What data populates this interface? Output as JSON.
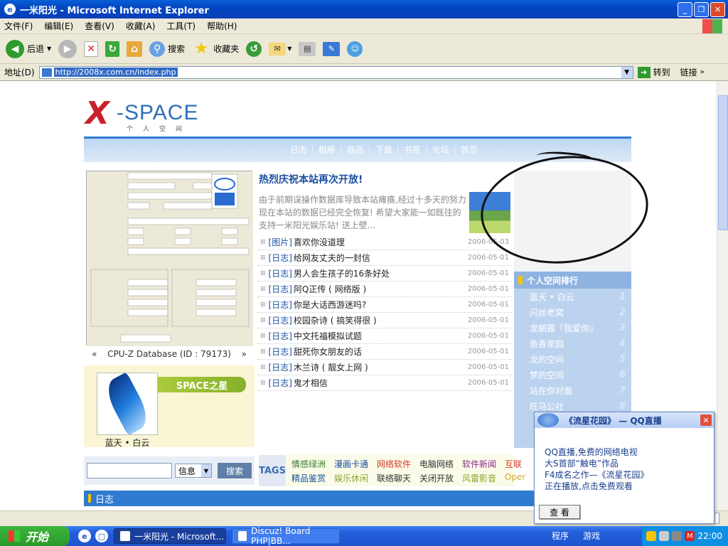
{
  "window": {
    "title": "一米阳光 - Microsoft Internet Explorer"
  },
  "menu": [
    "文件(F)",
    "编辑(E)",
    "查看(V)",
    "收藏(A)",
    "工具(T)",
    "帮助(H)"
  ],
  "toolbar": {
    "back": "后退",
    "search": "搜索",
    "favorites": "收藏夹"
  },
  "address": {
    "label": "地址(D)",
    "url": "http://2008x.com.cn/index.php",
    "go": "转到",
    "links": "链接"
  },
  "logo": {
    "x": "X",
    "space": "-SPACE",
    "sub": "个人空间"
  },
  "nav": [
    "日志",
    "相册",
    "商品",
    "下载",
    "书签",
    "论坛",
    "首页"
  ],
  "cpuz": {
    "prev": "«",
    "caption": "CPU-Z Database (ID : 79173)",
    "next": "»"
  },
  "star": {
    "badge": "SPACE之星",
    "name": "蓝天 • 白云"
  },
  "search": {
    "option": "信息",
    "button": "搜索"
  },
  "news": {
    "title": "热烈庆祝本站再次开放!",
    "body": "由于前期误操作数据库导致本站瘫痪,经过十多天的努力现在本站的数据已经完全恢复! 希望大家能一如既往的支持一米阳光娱乐站! 送上壁..."
  },
  "articles": [
    {
      "cat": "[图片]",
      "title": "喜欢你没道理",
      "date": "2006-05-03"
    },
    {
      "cat": "[日志]",
      "title": "给网友丈夫的一封信",
      "date": "2006-05-01"
    },
    {
      "cat": "[日志]",
      "title": "男人会生孩子的16条好处",
      "date": "2006-05-01"
    },
    {
      "cat": "[日志]",
      "title": "阿Q正传 ( 网络版 )",
      "date": "2006-05-01"
    },
    {
      "cat": "[日志]",
      "title": "你是大话西游迷吗?",
      "date": "2006-05-01"
    },
    {
      "cat": "[日志]",
      "title": "校园杂诗 ( 搞笑得很 )",
      "date": "2006-05-01"
    },
    {
      "cat": "[日志]",
      "title": "中文托福模拟试题",
      "date": "2006-05-01"
    },
    {
      "cat": "[日志]",
      "title": "甜死你女朋友的话",
      "date": "2006-05-01"
    },
    {
      "cat": "[日志]",
      "title": "木兰诗 ( 靓女上网 )",
      "date": "2006-05-01"
    },
    {
      "cat": "[日志]",
      "title": "鬼才相信",
      "date": "2006-05-01"
    }
  ],
  "rank": {
    "title": "个人空间排行",
    "items": [
      "蓝天 • 白云",
      "闪丝老窝",
      "龙朝霞『我爱你』",
      "鱼香家园",
      "龙的空间",
      "梦的空间",
      "站在你对面",
      "旺马公社"
    ],
    "nums": [
      "1",
      "2",
      "3",
      "4",
      "5",
      "6",
      "7",
      "8"
    ]
  },
  "tags": {
    "label": "TAGS",
    "items": [
      {
        "t": "情感绿洲",
        "c": "#3a7a2e"
      },
      {
        "t": "漫画卡通",
        "c": "#1a4fa0"
      },
      {
        "t": "网络软件",
        "c": "#d23b2b"
      },
      {
        "t": "电脑网络",
        "c": "#333333"
      },
      {
        "t": "软件新闻",
        "c": "#8a2d8a"
      },
      {
        "t": "互联",
        "c": "#d23b2b"
      },
      {
        "t": "精品鉴赏",
        "c": "#1a4fa0"
      },
      {
        "t": "娱乐休闲",
        "c": "#8aa82a"
      },
      {
        "t": "联络聊天",
        "c": "#333333"
      },
      {
        "t": "关闭开放",
        "c": "#333333"
      },
      {
        "t": "风雷影音",
        "c": "#8aa82a"
      },
      {
        "t": "Oper",
        "c": "#d2a82b"
      }
    ]
  },
  "section": {
    "title": "日志"
  },
  "qq": {
    "title": "《流星花园》 — QQ直播",
    "lines": [
      "QQ直播,免费的网络电视",
      "大S首部“触电”作品",
      "F4成名之作—《流星花园》",
      "正在播放,点击免费观看"
    ],
    "button": "查 看"
  },
  "taskbar": {
    "start": "开始",
    "task1": "一米阳光 - Microsoft...",
    "task2": "Discuz! Board PHP|BB...",
    "programs": "程序",
    "games": "游戏",
    "time": "22:00"
  }
}
